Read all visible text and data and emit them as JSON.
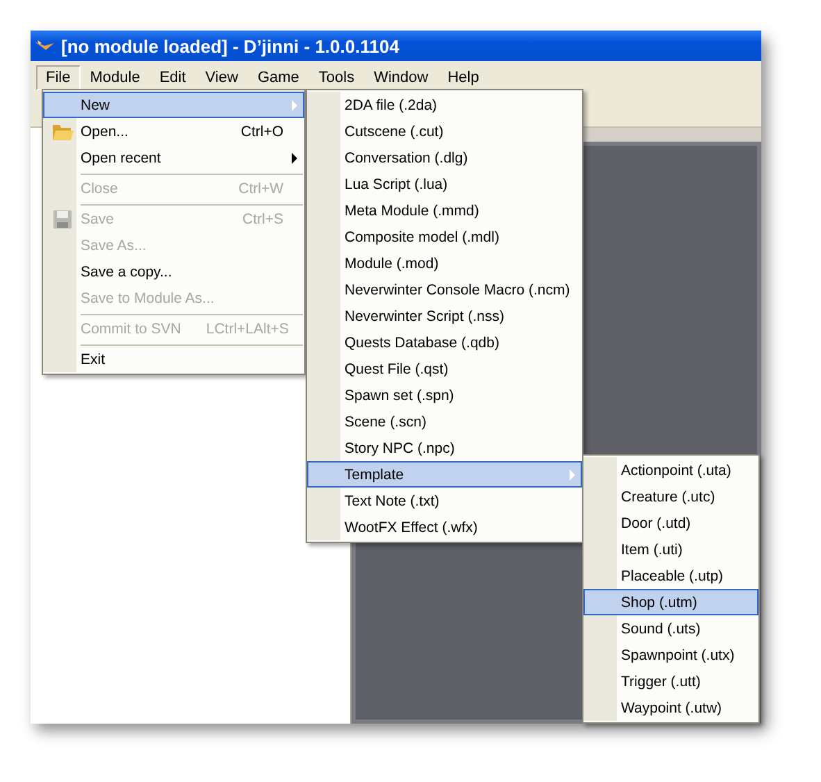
{
  "window": {
    "title": "[no module loaded] - D’jinni - 1.0.0.1104"
  },
  "menubar": [
    {
      "label": "File",
      "selected": true
    },
    {
      "label": "Module",
      "selected": false
    },
    {
      "label": "Edit",
      "selected": false
    },
    {
      "label": "View",
      "selected": false
    },
    {
      "label": "Game",
      "selected": false
    },
    {
      "label": "Tools",
      "selected": false
    },
    {
      "label": "Window",
      "selected": false
    },
    {
      "label": "Help",
      "selected": false
    }
  ],
  "file_menu": [
    {
      "kind": "plain",
      "label": "New",
      "selected": true,
      "disabled": false,
      "has_submenu": true,
      "divider_above": false
    },
    {
      "kind": "folder",
      "label": "Open...",
      "shortcut": "Ctrl+O",
      "selected": false,
      "disabled": false,
      "has_submenu": false,
      "divider_above": false
    },
    {
      "kind": "plain",
      "label": "Open recent",
      "selected": false,
      "disabled": false,
      "has_submenu": true,
      "divider_above": false
    },
    {
      "kind": "plain",
      "label": "Close",
      "shortcut": "Ctrl+W",
      "selected": false,
      "disabled": true,
      "has_submenu": false,
      "divider_above": true
    },
    {
      "kind": "disk",
      "label": "Save",
      "shortcut": "Ctrl+S",
      "selected": false,
      "disabled": true,
      "has_submenu": false,
      "divider_above": true
    },
    {
      "kind": "plain",
      "label": "Save As...",
      "selected": false,
      "disabled": true,
      "has_submenu": false,
      "divider_above": false
    },
    {
      "kind": "plain",
      "label": "Save a copy...",
      "selected": false,
      "disabled": false,
      "has_submenu": false,
      "divider_above": false
    },
    {
      "kind": "plain",
      "label": "Save to Module As...",
      "selected": false,
      "disabled": true,
      "has_submenu": false,
      "divider_above": false
    },
    {
      "kind": "plain",
      "label": "Commit to SVN",
      "shortcut": "LCtrl+LAlt+S",
      "selected": false,
      "disabled": true,
      "has_submenu": false,
      "divider_above": true
    },
    {
      "kind": "plain",
      "label": "Exit",
      "selected": false,
      "disabled": false,
      "has_submenu": false,
      "divider_above": true
    }
  ],
  "new_submenu": [
    {
      "label": "2DA file (.2da)",
      "selected": false,
      "has_submenu": false
    },
    {
      "label": "Cutscene (.cut)",
      "selected": false,
      "has_submenu": false
    },
    {
      "label": "Conversation (.dlg)",
      "selected": false,
      "has_submenu": false
    },
    {
      "label": "Lua Script (.lua)",
      "selected": false,
      "has_submenu": false
    },
    {
      "label": "Meta Module (.mmd)",
      "selected": false,
      "has_submenu": false
    },
    {
      "label": "Composite model (.mdl)",
      "selected": false,
      "has_submenu": false
    },
    {
      "label": "Module (.mod)",
      "selected": false,
      "has_submenu": false
    },
    {
      "label": "Neverwinter Console Macro (.ncm)",
      "selected": false,
      "has_submenu": false
    },
    {
      "label": "Neverwinter Script (.nss)",
      "selected": false,
      "has_submenu": false
    },
    {
      "label": "Quests Database (.qdb)",
      "selected": false,
      "has_submenu": false
    },
    {
      "label": "Quest File (.qst)",
      "selected": false,
      "has_submenu": false
    },
    {
      "label": "Spawn set (.spn)",
      "selected": false,
      "has_submenu": false
    },
    {
      "label": "Scene (.scn)",
      "selected": false,
      "has_submenu": false
    },
    {
      "label": "Story NPC (.npc)",
      "selected": false,
      "has_submenu": false
    },
    {
      "label": "Template",
      "selected": true,
      "has_submenu": true
    },
    {
      "label": "Text Note (.txt)",
      "selected": false,
      "has_submenu": false
    },
    {
      "label": "WootFX Effect (.wfx)",
      "selected": false,
      "has_submenu": false
    }
  ],
  "template_submenu": [
    {
      "label": "Actionpoint (.uta)",
      "selected": false
    },
    {
      "label": "Creature (.utc)",
      "selected": false
    },
    {
      "label": "Door (.utd)",
      "selected": false
    },
    {
      "label": "Item (.uti)",
      "selected": false
    },
    {
      "label": "Placeable (.utp)",
      "selected": false
    },
    {
      "label": "Shop (.utm)",
      "selected": true
    },
    {
      "label": "Sound (.uts)",
      "selected": false
    },
    {
      "label": "Spawnpoint (.utx)",
      "selected": false
    },
    {
      "label": "Trigger (.utt)",
      "selected": false
    },
    {
      "label": "Waypoint (.utw)",
      "selected": false
    }
  ]
}
